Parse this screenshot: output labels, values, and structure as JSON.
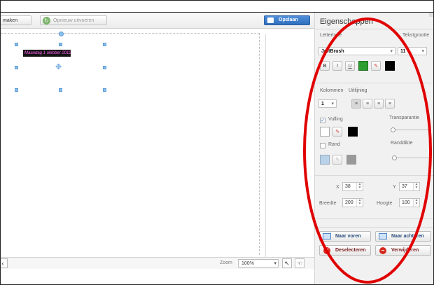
{
  "toolbar": {
    "undo_label": "maken",
    "redo_label": "Opnieuw uitvoeren",
    "save_label": "Opslaan"
  },
  "canvas": {
    "text_content": "Maandag 1 oktober 2012"
  },
  "statusbar": {
    "zoom_label": "Zoom",
    "zoom_value": "100%"
  },
  "panel": {
    "title": "Eigenschappen",
    "font_label": "Lettertype",
    "font_value": "JoltBrush",
    "size_label": "Tekstgrootte",
    "size_value": "11",
    "bold_label": "B",
    "italic_label": "I",
    "underline_label": "U",
    "columns_label": "Kolommen",
    "columns_value": "1",
    "align_label": "Uitlijning",
    "fill_label": "Vulling",
    "fill_checked": true,
    "transparency_label": "Transparantie",
    "border_label": "Rand",
    "border_checked": false,
    "border_width_label": "Randdikte",
    "x_label": "X",
    "x_value": "38",
    "y_label": "Y",
    "y_value": "37",
    "width_label": "Breedte",
    "width_value": "200",
    "height_label": "Hoogte",
    "height_value": "100",
    "bring_forward_label": "Naar voren",
    "send_backward_label": "Naar achteren",
    "deselect_label": "Deselecteren",
    "delete_label": "Verwijderen"
  },
  "colors": {
    "text_color": "#2e9e2e",
    "secondary_color": "#000000",
    "fill_color": "#000000",
    "border_color": "#999999",
    "annotation": "#e00000",
    "save_button": "#3a7bd0"
  },
  "icons": {
    "redo": "redo-icon",
    "save": "floppy-icon",
    "move": "move-icon",
    "eyedropper": "eyedropper-icon",
    "bring_forward": "bring-forward-icon",
    "send_backward": "send-backward-icon",
    "deselect": "deselect-icon",
    "delete": "delete-icon"
  }
}
